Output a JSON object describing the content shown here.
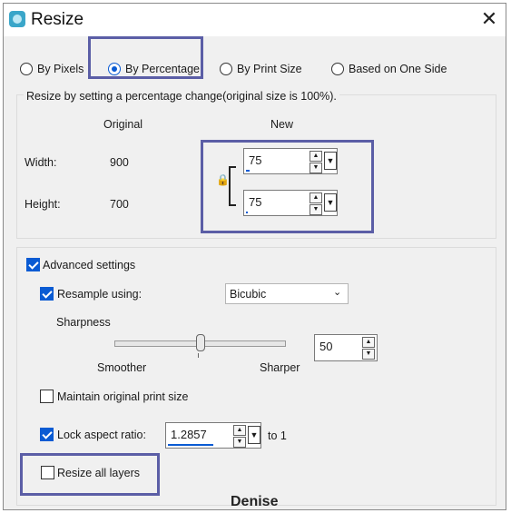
{
  "window": {
    "title": "Resize",
    "close_glyph": "✕"
  },
  "modes": [
    {
      "label": "By Pixels",
      "selected": false
    },
    {
      "label": "By Percentage",
      "selected": true
    },
    {
      "label": "By Print Size",
      "selected": false
    },
    {
      "label": "Based on One Side",
      "selected": false
    }
  ],
  "size_group": {
    "description": "Resize by setting a percentage change(original size is 100%).",
    "col_original": "Original",
    "col_new": "New",
    "width_label": "Width:",
    "width_original": "900",
    "width_new": "75",
    "height_label": "Height:",
    "height_original": "700",
    "height_new": "75",
    "link_icon": "padlock-icon"
  },
  "advanced": {
    "label": "Advanced settings",
    "checked": true,
    "resample_label": "Resample using:",
    "resample_checked": true,
    "resample_method": "Bicubic",
    "sharpness_label": "Sharpness",
    "sharpness_value": "50",
    "sharpness_level": 0.5,
    "slider_left": "Smoother",
    "slider_right": "Sharper",
    "maintain_print_label": "Maintain original print size",
    "maintain_print_checked": false,
    "lock_ratio_label": "Lock aspect ratio:",
    "lock_ratio_checked": true,
    "ratio_value": "1.2857",
    "ratio_suffix": "to 1",
    "resize_layers_label": "Resize all layers",
    "resize_layers_checked": false
  },
  "watermark": "Denise",
  "colors": {
    "accent": "#0a5bd3",
    "highlight": "#5b5ea6"
  }
}
